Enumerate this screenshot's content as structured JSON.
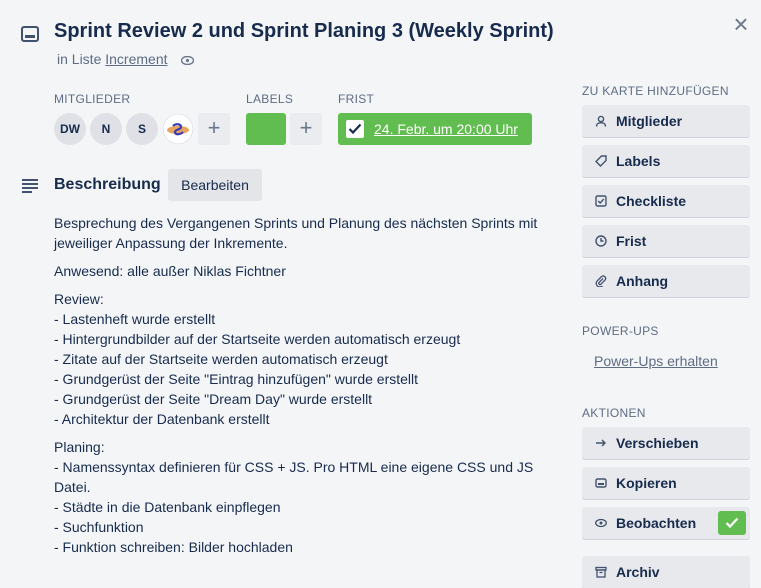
{
  "card": {
    "title": "Sprint Review 2 und Sprint Planing 3 (Weekly Sprint)",
    "in_list_prefix": "in Liste",
    "list_name": "Increment",
    "close_glyph": "×"
  },
  "members": {
    "heading": "Mitglieder",
    "avatars": [
      "DW",
      "N",
      "S"
    ],
    "add_glyph": "+"
  },
  "labels": {
    "heading": "Labels",
    "color": "#61bd4f",
    "add_glyph": "+"
  },
  "due": {
    "heading": "Frist",
    "date": "24. Febr. um 20:00 Uhr",
    "complete": true,
    "color": "#61bd4f"
  },
  "description": {
    "heading": "Beschreibung",
    "edit_label": "Bearbeiten",
    "paragraphs": [
      [
        "Besprechung des Vergangenen Sprints und Planung des nächsten Sprints mit",
        "jeweiliger Anpassung der Inkremente."
      ],
      [
        "Anwesend: alle außer Niklas Fichtner"
      ],
      [
        "Review:",
        "- Lastenheft wurde erstellt",
        "- Hintergrundbilder auf der Startseite werden automatisch erzeugt",
        "- Zitate auf der Startseite werden automatisch erzeugt",
        "- Grundgerüst der Seite \"Eintrag hinzufügen\" wurde erstellt",
        "- Grundgerüst der Seite \"Dream Day\" wurde erstellt",
        "- Architektur der Datenbank erstellt"
      ],
      [
        "Planing:",
        "- Namenssyntax definieren für CSS + JS. Pro HTML eine eigene CSS und JS",
        "Datei.",
        "- Städte in die Datenbank einpflegen",
        "- Suchfunktion",
        "- Funktion schreiben: Bilder hochladen"
      ]
    ]
  },
  "sidebar": {
    "add_heading": "Zu Karte hinzufügen",
    "add_buttons": [
      {
        "label": "Mitglieder",
        "icon": "person-icon"
      },
      {
        "label": "Labels",
        "icon": "tag-icon"
      },
      {
        "label": "Checkliste",
        "icon": "checklist-icon"
      },
      {
        "label": "Frist",
        "icon": "clock-icon"
      },
      {
        "label": "Anhang",
        "icon": "paperclip-icon"
      }
    ],
    "powerups_heading": "Power-Ups",
    "powerups_link": "Power-Ups erhalten",
    "actions_heading": "Aktionen",
    "action_buttons": [
      {
        "label": "Verschieben",
        "icon": "arrow-right-icon"
      },
      {
        "label": "Kopieren",
        "icon": "card-icon"
      },
      {
        "label": "Beobachten",
        "icon": "eye-icon",
        "active": true
      },
      {
        "label": "Archiv",
        "icon": "archive-icon"
      }
    ]
  }
}
